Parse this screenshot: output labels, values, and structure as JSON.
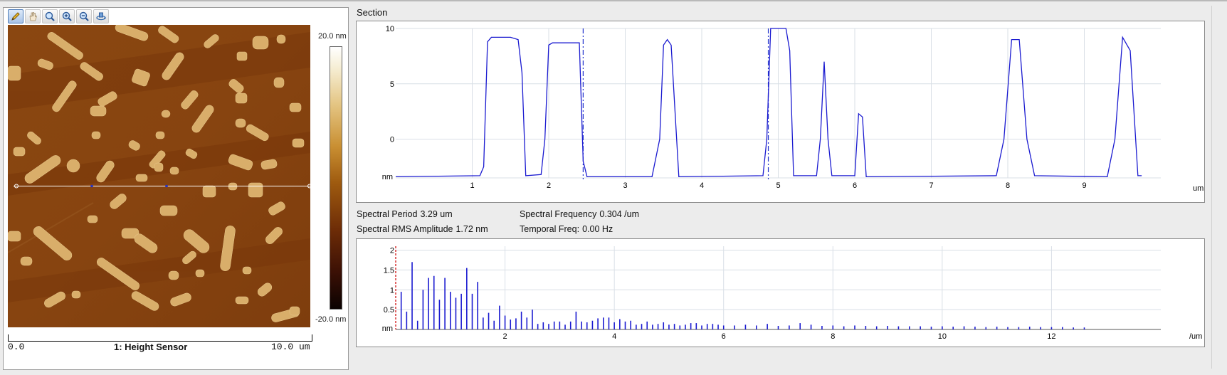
{
  "toolbar": {
    "buttons": [
      {
        "name": "pencil-icon",
        "active": true
      },
      {
        "name": "hand-icon",
        "active": false
      },
      {
        "name": "zoom-icon",
        "active": false
      },
      {
        "name": "zoom-in-icon",
        "active": false
      },
      {
        "name": "zoom-out-icon",
        "active": false
      },
      {
        "name": "rotate-icon",
        "active": false
      }
    ]
  },
  "image_panel": {
    "colorbar_max": "20.0 nm",
    "colorbar_min": "-20.0 nm",
    "axis_start": "0.0",
    "channel_label": "1: Height Sensor",
    "axis_end": "10.0 um"
  },
  "section": {
    "title": "Section",
    "y_unit": "nm",
    "x_unit": "um",
    "y_ticks": [
      "10",
      "5",
      "0"
    ],
    "x_ticks": [
      "1",
      "2",
      "3",
      "4",
      "5",
      "6",
      "7",
      "8",
      "9"
    ],
    "cursor_positions_um": [
      2.45,
      4.87
    ],
    "chart_data": {
      "type": "line",
      "xlabel": "um",
      "ylabel": "nm",
      "xlim": [
        0,
        10
      ],
      "ylim": [
        -3.5,
        10
      ],
      "x": [
        0,
        1.1,
        1.15,
        1.2,
        1.25,
        1.5,
        1.6,
        1.65,
        1.7,
        1.9,
        1.95,
        2.0,
        2.05,
        2.4,
        2.45,
        2.5,
        3.35,
        3.45,
        3.5,
        3.55,
        3.6,
        3.7,
        4.8,
        4.85,
        4.9,
        5.1,
        5.15,
        5.2,
        5.5,
        5.55,
        5.6,
        5.65,
        5.7,
        6.0,
        6.05,
        6.1,
        6.15,
        6.2,
        7.85,
        7.95,
        8.05,
        8.15,
        8.25,
        8.35,
        9.3,
        9.4,
        9.5,
        9.6,
        9.7,
        9.75
      ],
      "y": [
        -3.4,
        -3.3,
        -2.5,
        8.8,
        9.2,
        9.2,
        9.0,
        6.0,
        -3.3,
        -3.2,
        0,
        8.5,
        8.7,
        8.7,
        -2.0,
        -3.4,
        -3.4,
        0,
        8.5,
        9.0,
        8.5,
        -3.4,
        -3.3,
        0,
        10.0,
        10.0,
        8.0,
        -3.3,
        -3.3,
        0,
        7.0,
        0,
        -3.3,
        -3.3,
        2.3,
        2.0,
        -3.4,
        -3.4,
        -3.3,
        0,
        9.0,
        9.0,
        0,
        -3.3,
        -3.4,
        0,
        9.2,
        8.0,
        -3.3,
        -3.3
      ]
    }
  },
  "info": {
    "spectral_period_label": "Spectral Period",
    "spectral_period_value": "3.29 um",
    "spectral_frequency_label": "Spectral Frequency",
    "spectral_frequency_value": "0.304 /um",
    "rms_amplitude_label": "Spectral RMS Amplitude",
    "rms_amplitude_value": "1.72 nm",
    "temporal_freq_label": "Temporal Freq:",
    "temporal_freq_value": "0.00 Hz"
  },
  "spectrum": {
    "y_unit": "nm",
    "x_unit": "/um",
    "y_ticks": [
      "2",
      "1.5",
      "1",
      "0.5"
    ],
    "x_ticks": [
      "2",
      "4",
      "6",
      "8",
      "10",
      "12"
    ],
    "chart_data": {
      "type": "bar",
      "xlabel": "/um",
      "ylabel": "nm",
      "xlim": [
        0,
        14
      ],
      "ylim": [
        0,
        2.1
      ],
      "x": [
        0.1,
        0.2,
        0.3,
        0.4,
        0.5,
        0.6,
        0.7,
        0.8,
        0.9,
        1.0,
        1.1,
        1.2,
        1.3,
        1.4,
        1.5,
        1.6,
        1.7,
        1.8,
        1.9,
        2.0,
        2.1,
        2.2,
        2.3,
        2.4,
        2.5,
        2.6,
        2.7,
        2.8,
        2.9,
        3.0,
        3.1,
        3.2,
        3.3,
        3.4,
        3.5,
        3.6,
        3.7,
        3.8,
        3.9,
        4.0,
        4.1,
        4.2,
        4.3,
        4.4,
        4.5,
        4.6,
        4.7,
        4.8,
        4.9,
        5.0,
        5.1,
        5.2,
        5.3,
        5.4,
        5.5,
        5.6,
        5.7,
        5.8,
        5.9,
        6.0,
        6.2,
        6.4,
        6.6,
        6.8,
        7.0,
        7.2,
        7.4,
        7.6,
        7.8,
        8.0,
        8.2,
        8.4,
        8.6,
        8.8,
        9.0,
        9.2,
        9.4,
        9.6,
        9.8,
        10.0,
        10.2,
        10.4,
        10.6,
        10.8,
        11.0,
        11.2,
        11.4,
        11.6,
        11.8,
        12.0,
        12.2,
        12.4,
        12.6
      ],
      "values": [
        0.95,
        0.45,
        1.7,
        0.22,
        1.0,
        1.3,
        1.35,
        0.75,
        1.3,
        0.95,
        0.8,
        0.9,
        1.55,
        0.9,
        1.2,
        0.3,
        0.42,
        0.22,
        0.6,
        0.35,
        0.25,
        0.28,
        0.45,
        0.3,
        0.5,
        0.14,
        0.18,
        0.14,
        0.2,
        0.2,
        0.12,
        0.2,
        0.45,
        0.2,
        0.18,
        0.22,
        0.28,
        0.3,
        0.3,
        0.18,
        0.26,
        0.2,
        0.22,
        0.12,
        0.14,
        0.2,
        0.12,
        0.14,
        0.18,
        0.12,
        0.14,
        0.1,
        0.12,
        0.16,
        0.16,
        0.1,
        0.14,
        0.14,
        0.12,
        0.1,
        0.1,
        0.12,
        0.1,
        0.14,
        0.09,
        0.1,
        0.16,
        0.12,
        0.09,
        0.1,
        0.08,
        0.1,
        0.09,
        0.08,
        0.09,
        0.08,
        0.08,
        0.08,
        0.07,
        0.08,
        0.07,
        0.08,
        0.07,
        0.06,
        0.07,
        0.06,
        0.06,
        0.07,
        0.06,
        0.06,
        0.06,
        0.05,
        0.05
      ]
    }
  },
  "colors": {
    "trace": "#1a1ad0",
    "cursor": "#2233cc",
    "grid": "#d9dfe6",
    "marker": "#cc0000"
  }
}
